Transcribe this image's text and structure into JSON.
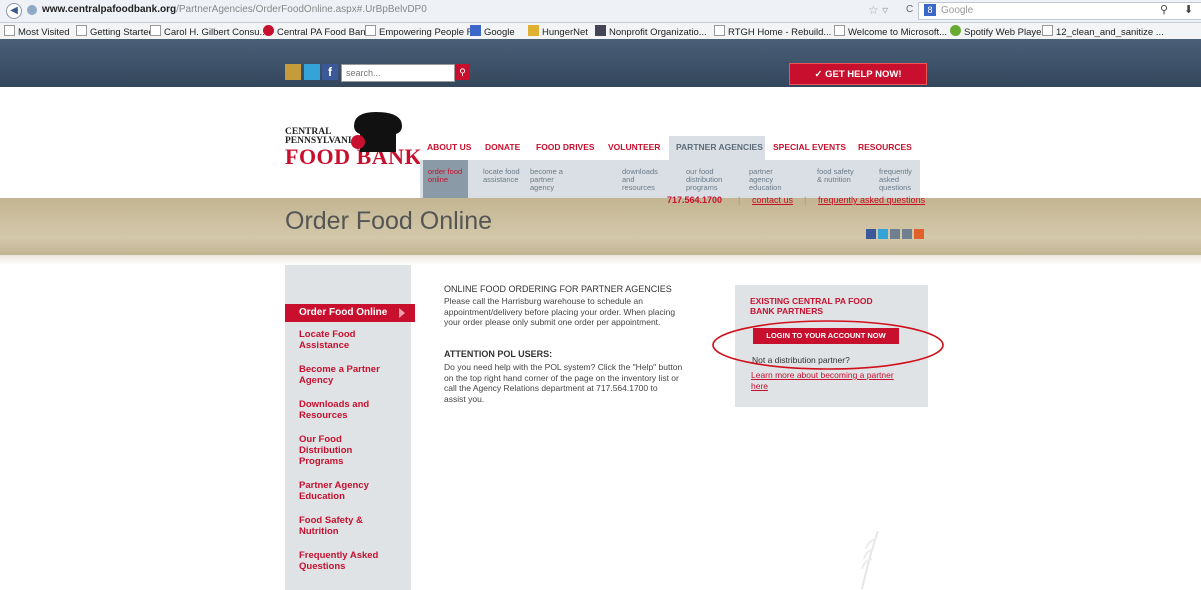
{
  "browser": {
    "url_domain": "www.centralpafoodbank.org",
    "url_path": "/PartnerAgencies/OrderFoodOnline.aspx#.UrBpBelvDP0",
    "search_engine": "Google",
    "bookmarks": [
      "Most Visited",
      "Getting Started",
      "Carol H. Gilbert Consu...",
      "Central PA Food Bank",
      "Empowering People F...",
      "Google",
      "HungerNet",
      "Nonprofit Organizatio...",
      "RTGH Home - Rebuild...",
      "Welcome to Microsoft...",
      "Spotify Web Player",
      "12_clean_and_sanitize ..."
    ]
  },
  "topbar": {
    "search_placeholder": "search...",
    "help_button": "GET HELP NOW!",
    "facebook_glyph": "f"
  },
  "logo": {
    "line1": "CENTRAL",
    "line2": "PENNSYLVANIA",
    "line3": "FOOD BANK"
  },
  "nav": {
    "items": [
      "ABOUT US",
      "DONATE",
      "FOOD DRIVES",
      "VOLUNTEER",
      "PARTNER AGENCIES",
      "SPECIAL EVENTS",
      "RESOURCES"
    ],
    "active": "PARTNER AGENCIES"
  },
  "subnav": [
    [
      "order food",
      "online"
    ],
    [
      "locate food",
      "assistance"
    ],
    [
      "become a",
      "partner",
      "agency"
    ],
    [
      "downloads",
      "and",
      "resources"
    ],
    [
      "our food",
      "distribution",
      "programs"
    ],
    [
      "partner",
      "agency",
      "education"
    ],
    [
      "food safety",
      "& nutrition"
    ],
    [
      "frequently",
      "asked",
      "questions"
    ]
  ],
  "hero": {
    "title": "Order Food Online",
    "phone": "717.564.1700",
    "separator": "|",
    "contact": "contact us",
    "faq": "frequently asked questions"
  },
  "sidebar": {
    "active": "Order Food Online",
    "items": [
      [
        "Locate Food",
        "Assistance"
      ],
      [
        "Become a Partner",
        "Agency"
      ],
      [
        "Downloads and",
        "Resources"
      ],
      [
        "Our Food",
        "Distribution",
        "Programs"
      ],
      [
        "Partner Agency",
        "Education"
      ],
      [
        "Food Safety &",
        "Nutrition"
      ],
      [
        "Frequently Asked",
        "Questions"
      ]
    ]
  },
  "content": {
    "heading": "ONLINE FOOD ORDERING FOR PARTNER AGENCIES",
    "p1": [
      "Please call the Harrisburg warehouse to schedule an",
      "appointment/delivery before placing your order. When placing",
      "your order please only submit one order per appointment."
    ],
    "attention": "ATTENTION POL USERS:",
    "p2": [
      "Do you need help with the POL system? Click the \"Help\" button",
      "on the top right hand corner of the page on the inventory list or",
      "call the Agency Relations department at 717.564.1700 to",
      "assist you."
    ]
  },
  "partner_box": {
    "title_line1": "EXISTING CENTRAL PA FOOD",
    "title_line2": "BANK PARTNERS",
    "login_button": "LOGIN TO YOUR ACCOUNT NOW",
    "not_partner": "Not a distribution partner?",
    "learn_line1": "Learn more about becoming a partner",
    "learn_line2": "here"
  },
  "colors": {
    "brand_red": "#c8102e",
    "topbar": "#3d5168",
    "hero_tan": "#cdc1a0",
    "sidebar_gray": "#dfe3e6"
  }
}
